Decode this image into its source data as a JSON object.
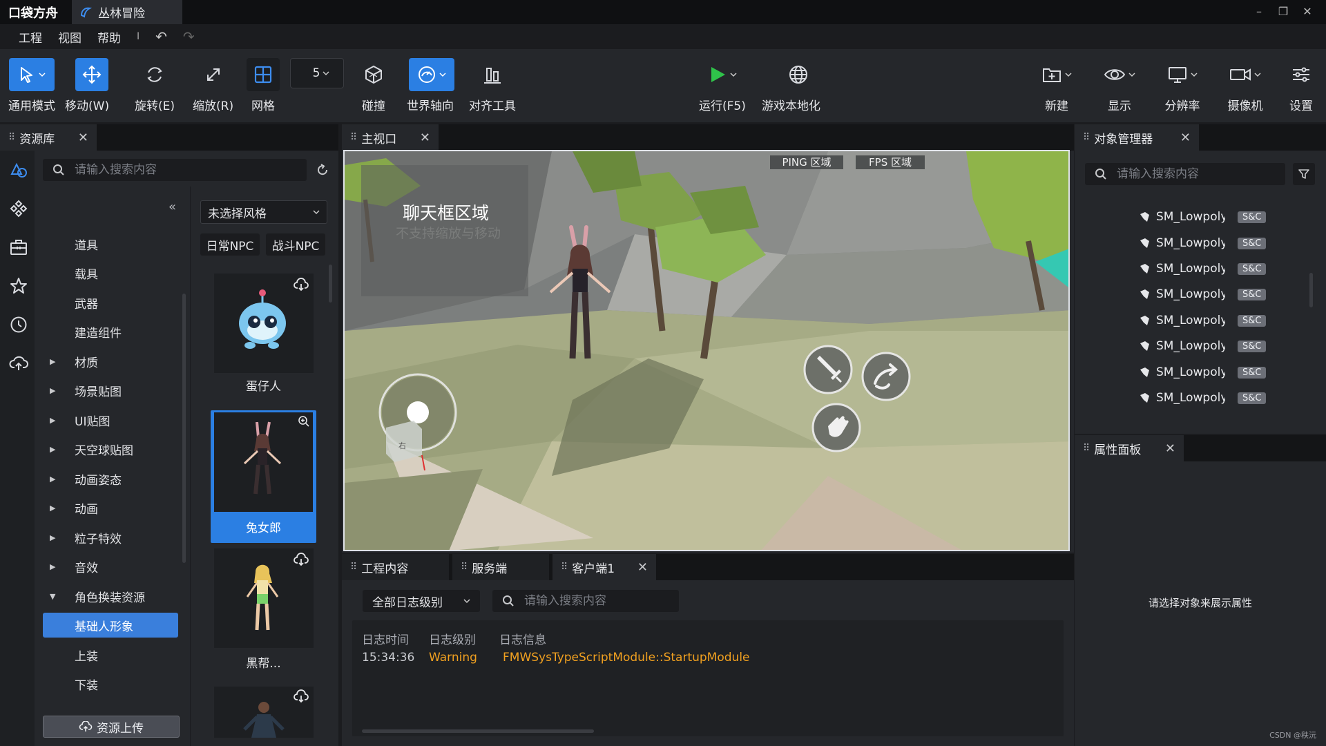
{
  "app": {
    "logo": "口袋方舟",
    "document_tab": "丛林冒险",
    "window_controls": [
      "–",
      "❐",
      "✕"
    ]
  },
  "menu": {
    "items": [
      "工程",
      "视图",
      "帮助"
    ],
    "separator": "I"
  },
  "toolbar": {
    "general_mode": "通用模式",
    "move": "移动(W)",
    "rotate": "旋转(E)",
    "scale": "缩放(R)",
    "grid": "网格",
    "grid_size": "5",
    "collision": "碰撞",
    "world_axis": "世界轴向",
    "align_tool": "对齐工具",
    "run": "运行(F5)",
    "localize": "游戏本地化",
    "new": "新建",
    "display": "显示",
    "resolution": "分辨率",
    "camera": "摄像机",
    "settings": "设置"
  },
  "asset_library": {
    "tab_title": "资源库",
    "search_placeholder": "请输入搜索内容",
    "categories": [
      {
        "label": "道具",
        "expandable": false
      },
      {
        "label": "载具",
        "expandable": false
      },
      {
        "label": "武器",
        "expandable": false
      },
      {
        "label": "建造组件",
        "expandable": false
      },
      {
        "label": "材质",
        "expandable": true
      },
      {
        "label": "场景贴图",
        "expandable": true
      },
      {
        "label": "UI贴图",
        "expandable": true
      },
      {
        "label": "天空球贴图",
        "expandable": true
      },
      {
        "label": "动画姿态",
        "expandable": true
      },
      {
        "label": "动画",
        "expandable": true
      },
      {
        "label": "粒子特效",
        "expandable": true
      },
      {
        "label": "音效",
        "expandable": true
      },
      {
        "label": "角色换装资源",
        "expandable": true,
        "expanded": true
      },
      {
        "label": "基础人形象",
        "expandable": false,
        "active": true
      },
      {
        "label": "上装",
        "expandable": false
      },
      {
        "label": "下装",
        "expandable": false
      }
    ],
    "style_select": "未选择风格",
    "filters": [
      "日常NPC",
      "战斗NPC"
    ],
    "items": [
      {
        "name": "蛋仔人"
      },
      {
        "name": "兔女郎"
      },
      {
        "name": "黑帮..."
      },
      {
        "name": ""
      }
    ],
    "upload_button": "资源上传"
  },
  "viewport": {
    "tab_title": "主视口",
    "ping_label": "PING 区域",
    "fps_label": "FPS 区域",
    "chat_title": "聊天框区域",
    "chat_subtitle": "不支持缩放与移动",
    "gizmo_label": "右"
  },
  "console": {
    "tabs": [
      "工程内容",
      "服务端",
      "客户端1"
    ],
    "level_select": "全部日志级别",
    "search_placeholder": "请输入搜索内容",
    "columns": [
      "日志时间",
      "日志级别",
      "日志信息"
    ],
    "rows": [
      {
        "time": "15:34:36",
        "level": "Warning",
        "message": "FMWSysTypeScriptModule::StartupModule"
      }
    ],
    "warning_color": "#f0a020"
  },
  "object_manager": {
    "tab_title": "对象管理器",
    "search_placeholder": "请输入搜索内容",
    "items": [
      {
        "name": "SM_Lowpoly",
        "badge": "S&C"
      },
      {
        "name": "SM_Lowpoly",
        "badge": "S&C"
      },
      {
        "name": "SM_Lowpoly",
        "badge": "S&C"
      },
      {
        "name": "SM_Lowpoly",
        "badge": "S&C"
      },
      {
        "name": "SM_Lowpoly",
        "badge": "S&C"
      },
      {
        "name": "SM_Lowpoly",
        "badge": "S&C"
      },
      {
        "name": "SM_Lowpoly",
        "badge": "S&C"
      },
      {
        "name": "SM_Lowpoly",
        "badge": "S&C"
      }
    ]
  },
  "properties": {
    "tab_title": "属性面板",
    "empty_message": "请选择对象来展示属性"
  },
  "watermark": "CSDN @秩沅",
  "colors": {
    "accent": "#2b7fe3",
    "run_green": "#2fc24a",
    "panel_bg": "#25272b",
    "warning": "#f0a020"
  }
}
